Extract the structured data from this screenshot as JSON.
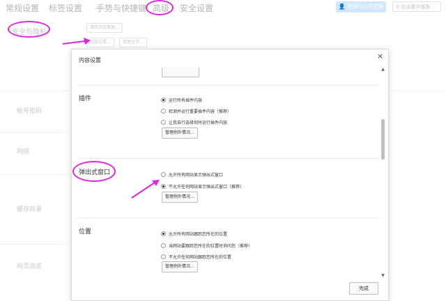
{
  "top_tabs": [
    {
      "label": "常规设置"
    },
    {
      "label": "标签设置"
    },
    {
      "label": "手势与快捷键"
    },
    {
      "label": "高级"
    },
    {
      "label": "安全设置"
    }
  ],
  "header": {
    "login_label": "登录QQ浏览器",
    "search_placeholder": "在设置中搜索"
  },
  "background": {
    "section_title": "安全与隐私",
    "clear_button": "清除浏览数据...",
    "content_button": "内容设置...",
    "cert_button": "管理证书...",
    "left_labels": [
      "帐号密码",
      "网络",
      "缓存目录",
      "网页浏览"
    ]
  },
  "dialog": {
    "title": "内容设置",
    "close_glyph": "×",
    "done_label": "完成",
    "scroll_up_glyph": "▲",
    "scroll_down_glyph": "▼",
    "sections": [
      {
        "title": "插件",
        "options": [
          {
            "label": "运行所有插件内容",
            "selected": true
          },
          {
            "label": "检测并运行重要插件内容（推荐）",
            "selected": false
          },
          {
            "label": "让我自行选择何时运行插件内容",
            "selected": false
          }
        ],
        "manage_label": "管理例外情况..."
      },
      {
        "title": "弹出式窗口",
        "options": [
          {
            "label": "允许所有网站显示弹出式窗口",
            "selected": false
          },
          {
            "label": "不允许任何网站显示弹出式窗口（推荐）",
            "selected": true
          }
        ],
        "manage_label": "管理例外情况..."
      },
      {
        "title": "位置",
        "options": [
          {
            "label": "允许所有网站跟踪您所在的位置",
            "selected": true
          },
          {
            "label": "当网站要跟踪您所在的位置时询问您（推荐）",
            "selected": false
          },
          {
            "label": "不允许任何网站跟踪您所在的位置",
            "selected": false
          }
        ],
        "manage_label": "管理例外情况..."
      }
    ]
  },
  "colors": {
    "annotation": "#e026dc",
    "login_bg": "#cfe6fb"
  }
}
